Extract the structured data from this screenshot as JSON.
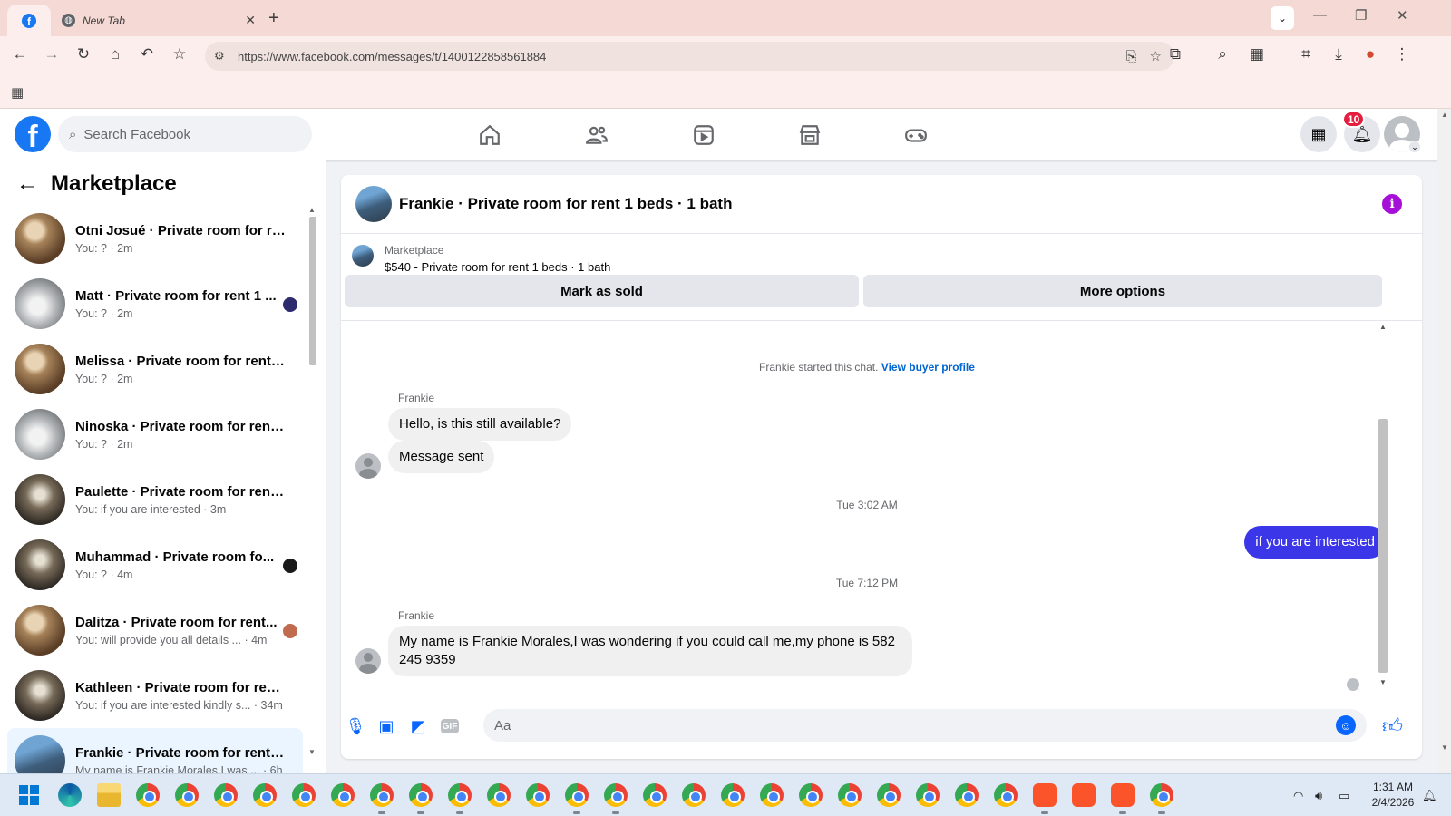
{
  "browser": {
    "tabs": [
      {
        "title": "",
        "favicon": "facebook-icon",
        "active": true
      },
      {
        "title": "New Tab",
        "favicon": "globe-icon",
        "active": false
      }
    ],
    "url": "https://www.facebook.com/messages/t/1400122858561884"
  },
  "facebook": {
    "search_placeholder": "Search Facebook",
    "notification_count": "10"
  },
  "sidebar": {
    "title": "Marketplace",
    "conversations": [
      {
        "name": "Otni Josué · Private room for re...",
        "snippet": "You: ? · 2m",
        "thumb": "room-warm",
        "badge": ""
      },
      {
        "name": "Matt · Private room for rent 1 ...",
        "snippet": "You: ? · 2m",
        "thumb": "room-white",
        "badge": "#2d2a6e"
      },
      {
        "name": "Melissa · Private room for rent 1...",
        "snippet": "You: ? · 2m",
        "thumb": "room-warm",
        "badge": ""
      },
      {
        "name": "Ninoska · Private room for rent ...",
        "snippet": "You: ? · 2m",
        "thumb": "room-white",
        "badge": ""
      },
      {
        "name": "Paulette · Private room for rent ...",
        "snippet": "You: if you are interested · 3m",
        "thumb": "room-dark",
        "badge": ""
      },
      {
        "name": "Muhammad · Private room fo...",
        "snippet": "You: ? · 4m",
        "thumb": "room-dark",
        "badge": "#1a1a1a"
      },
      {
        "name": "Dalitza · Private room for rent...",
        "snippet": "You: will provide you all details ... · 4m",
        "thumb": "room-warm",
        "badge": "#c06a4e"
      },
      {
        "name": "Kathleen · Private room for rent ...",
        "snippet": "You: if you are interested kindly s... · 34m",
        "thumb": "room-dark",
        "badge": ""
      },
      {
        "name": "Frankie · Private room for rent 1 ...",
        "snippet": "My name is Frankie Morales,I was ... · 6h",
        "thumb": "room-blue",
        "badge": "",
        "selected": true
      }
    ]
  },
  "chat": {
    "title": "Frankie · Private room for rent 1 beds · 1 bath",
    "marketplace_label": "Marketplace",
    "listing": "$540 - Private room for rent 1 beds · 1 bath",
    "mark_sold_label": "Mark as sold",
    "more_options_label": "More options",
    "started_text": "Frankie started this chat.",
    "view_profile_label": "View buyer profile",
    "sender_1": "Frankie",
    "msg_1": "Hello, is this still available?",
    "msg_2": "Message sent",
    "timestamp_1": "Tue 3:02 AM",
    "msg_out": "if you are interested",
    "timestamp_2": "Tue 7:12 PM",
    "sender_2": "Frankie",
    "msg_3": "My name is Frankie Morales,I was wondering if you could call me,my phone is 582 245 9359",
    "input_placeholder": "Aa"
  },
  "taskbar": {
    "time": "1:31 AM",
    "date": "2/4/2026"
  },
  "colors": {
    "fb_blue": "#1877f2",
    "outgoing_bubble": "#3b36e8",
    "info_purple": "#a50fd8",
    "notification_red": "#e41e3f"
  }
}
